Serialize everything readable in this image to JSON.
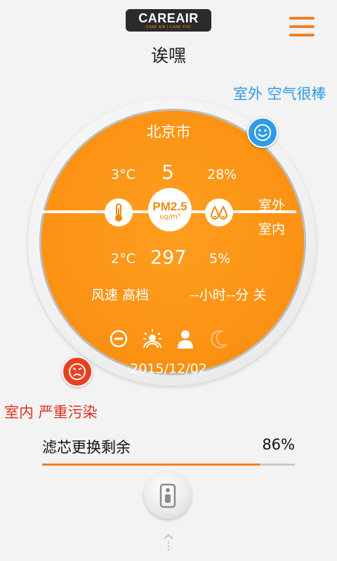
{
  "header": {
    "logo_text": "CAREAIR",
    "logo_tagline": "CARE AIR | CARE YOU",
    "title": "诶嘿"
  },
  "status": {
    "outdoor": "室外 空气很棒",
    "indoor": "室内 严重污染"
  },
  "dial": {
    "city": "北京市",
    "outdoor": {
      "temperature": "3°C",
      "pm25": "5",
      "humidity": "28%"
    },
    "indoor": {
      "temperature": "2°C",
      "pm25": "297",
      "humidity": "5%"
    },
    "label_outdoor": "室外",
    "label_indoor": "室内",
    "pm_label": "PM2.5",
    "pm_unit": "ug/m³",
    "fan_speed": "风速 高档",
    "timer": "--小时--分 关",
    "date": "2015/12/02",
    "mode_icons": [
      "minus-circle-icon",
      "sun-icon",
      "person-icon",
      "moon-icon"
    ]
  },
  "filter": {
    "label": "滤芯更换剩余",
    "value": "86%",
    "percent": 86
  },
  "colors": {
    "accent": "#f28022",
    "dial_orange": "#fb9113",
    "good_blue": "#2e9ae8",
    "bad_red": "#e8401f"
  }
}
